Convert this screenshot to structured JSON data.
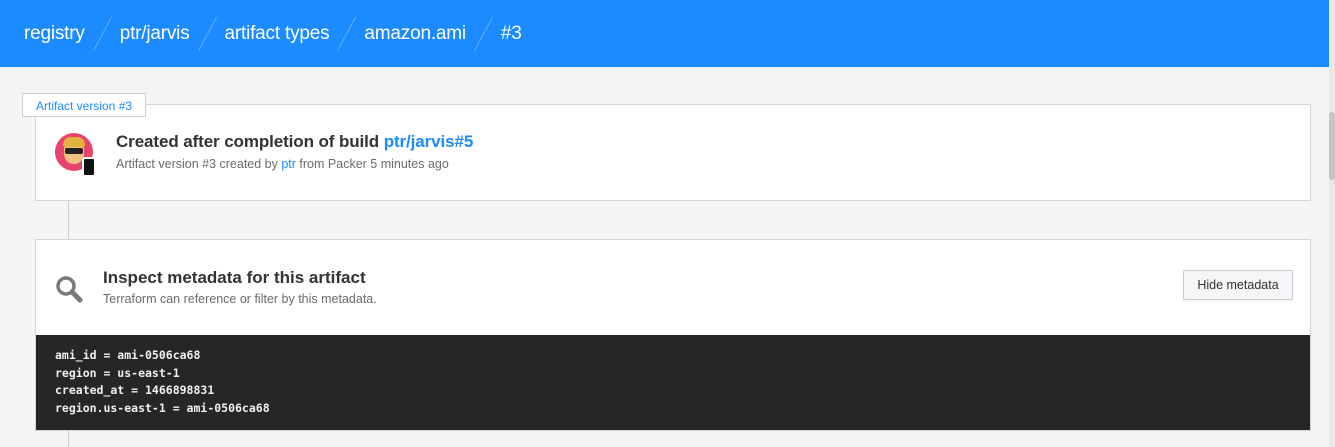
{
  "breadcrumb": [
    "registry",
    "ptr/jarvis",
    "artifact types",
    "amazon.ami",
    "#3"
  ],
  "version_tag": "Artifact version #3",
  "build_card": {
    "title_prefix": "Created after completion of build ",
    "build_link": "ptr/jarvis#5",
    "subtitle_prefix": "Artifact version #3 created by ",
    "user": "ptr",
    "subtitle_suffix": " from Packer 5 minutes ago"
  },
  "metadata_card": {
    "title": "Inspect metadata for this artifact",
    "subtitle": "Terraform can reference or filter by this metadata.",
    "button_label": "Hide metadata",
    "lines": [
      "ami_id = ami-0506ca68",
      "region = us-east-1",
      "created_at = 1466898831",
      "region.us-east-1 = ami-0506ca68"
    ]
  },
  "colors": {
    "header": "#1b8bff",
    "link": "#1b8bff",
    "code_bg": "#262626"
  },
  "icons": [
    "user-avatar",
    "search-icon"
  ]
}
